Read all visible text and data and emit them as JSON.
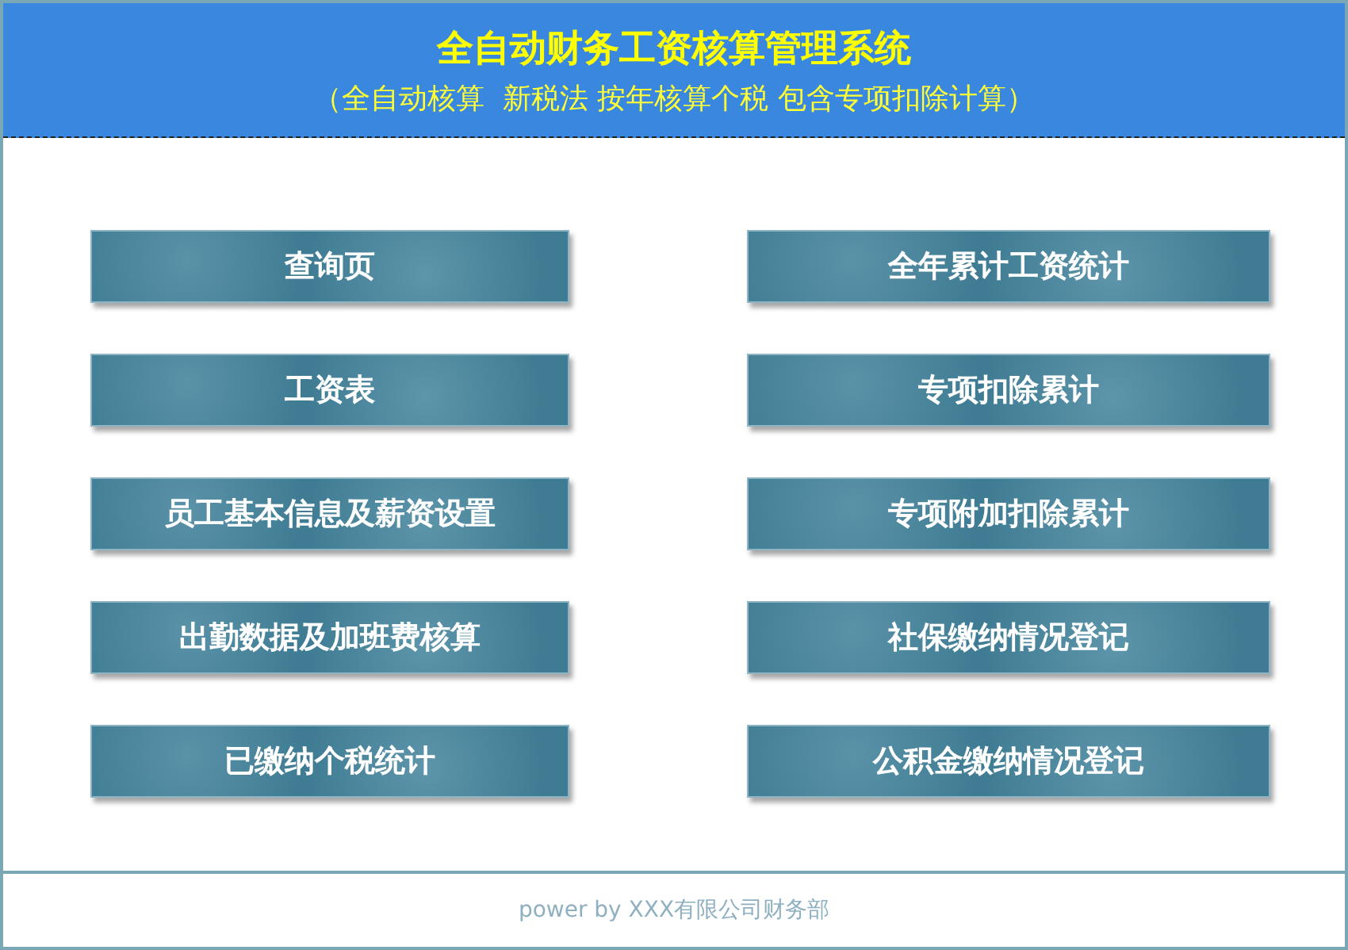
{
  "header": {
    "title": "全自动财务工资核算管理系统",
    "subtitle": "（全自动核算  新税法 按年核算个税 包含专项扣除计算）"
  },
  "columns": [
    [
      "查询页",
      "工资表",
      "员工基本信息及薪资设置",
      "出勤数据及加班费核算",
      "已缴纳个税统计"
    ],
    [
      "全年累计工资统计",
      "专项扣除累计",
      "专项附加扣除累计",
      "社保缴纳情况登记",
      "公积金缴纳情况登记"
    ]
  ],
  "footer": "power by XXX有限公司财务部"
}
